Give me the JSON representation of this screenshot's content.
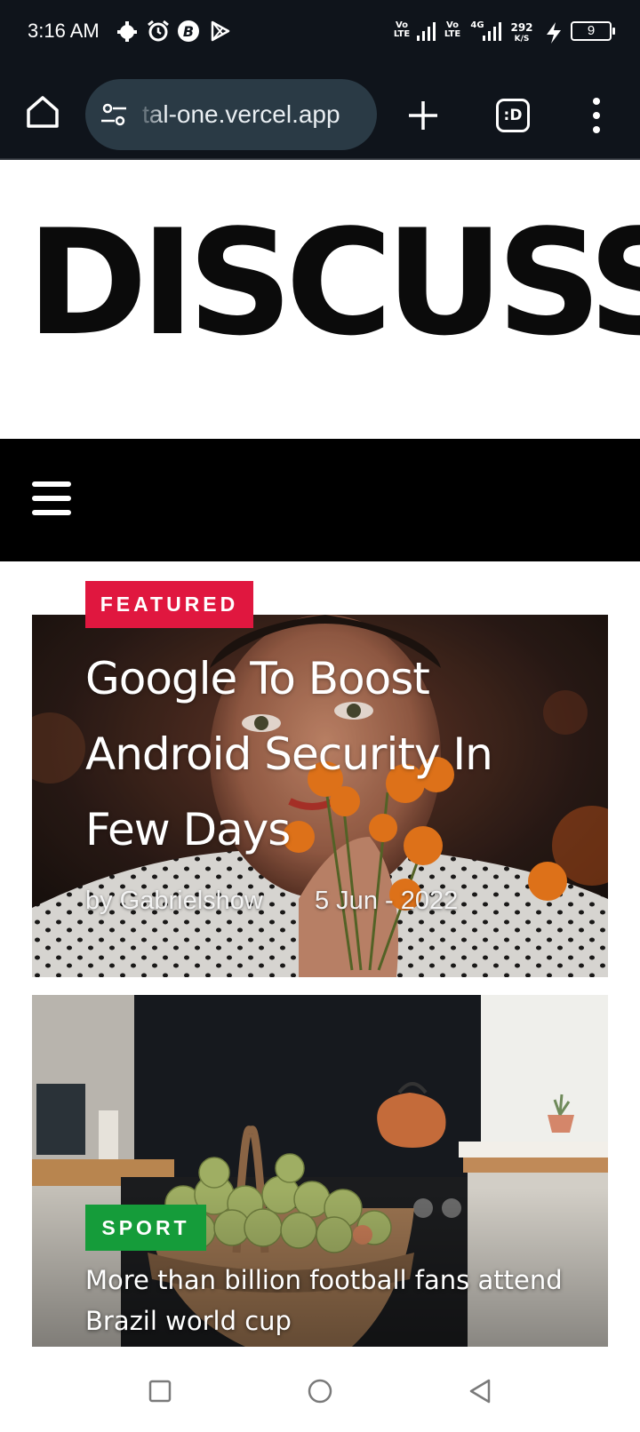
{
  "status_bar": {
    "time": "3:16 AM",
    "net1": "Vo\nLTE",
    "net2": "Vo\nLTE",
    "net_4g": "4G",
    "speed_value": "292",
    "speed_unit": "K/S",
    "battery": "9",
    "icons": [
      "notification-app-icon",
      "alarm-icon",
      "b-app-icon",
      "play-store-icon",
      "signal-icon",
      "signal-icon",
      "charging-icon",
      "battery-icon"
    ]
  },
  "browser": {
    "url": "tal-one.vercel.app",
    "tabs_label": ":D",
    "icons": [
      "home-icon",
      "site-settings-icon",
      "plus-icon",
      "tabs-icon",
      "more-vert-icon"
    ]
  },
  "site": {
    "logo": "DISCUSS"
  },
  "featured": {
    "tag": "FEATURED",
    "title": "Google To Boost Android Security In Few Days",
    "author": "by Gabrielshow",
    "date": "5 Jun - 2022",
    "tag_color": "#e0173f"
  },
  "sport": {
    "tag": "SPORT",
    "title": "More than billion football fans attend Brazil world cup",
    "tag_color": "#159c3a"
  },
  "android_nav": {
    "icons": [
      "recents-square-icon",
      "home-circle-icon",
      "back-triangle-icon"
    ]
  }
}
